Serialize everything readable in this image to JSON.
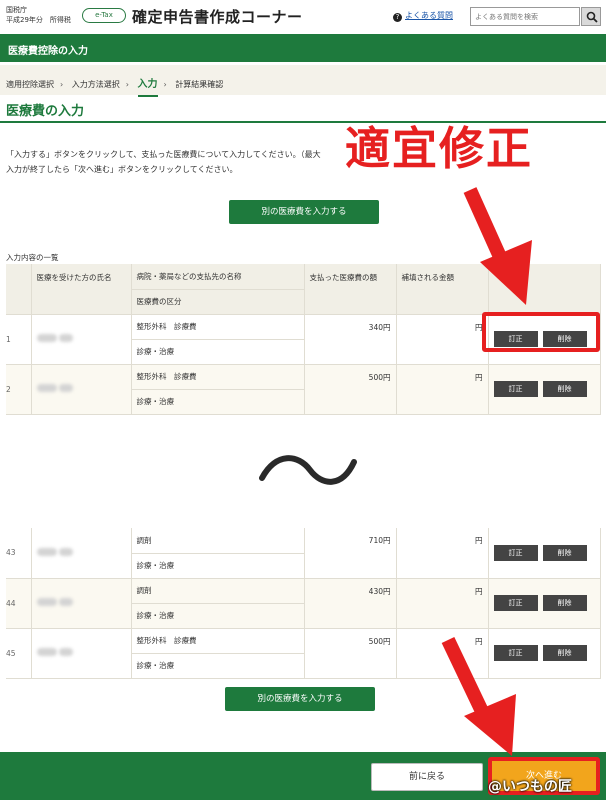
{
  "header": {
    "agency_line1": "国税庁",
    "agency_line2": "平成29年分　所得税",
    "etax_badge": "e-Tax",
    "app_title": "確定申告書作成コーナー",
    "faq_link": "よくある質問",
    "search_placeholder": "よくある質問を検索"
  },
  "section_bar": {
    "title": "医療費控除の入力"
  },
  "steps": [
    "適用控除選択",
    "入力方法選択",
    "入力",
    "計算結果確認"
  ],
  "page_title": "医療費の入力",
  "instructions": {
    "line1": "「入力する」ボタンをクリックして、支払った医療費について入力してください。（最大",
    "line2": "入力が終了したら「次へ進む」ボタンをクリックしてください。"
  },
  "annotation": {
    "overlay_text": "適宜修正"
  },
  "add_button_label": "別の医療費を入力する",
  "list_label": "入力内容の一覧",
  "table": {
    "headers": {
      "patient": "医療を受けた方の氏名",
      "provider": "病院・薬局などの支払先の名称",
      "category": "医療費の区分",
      "paid": "支払った医療費の額",
      "reimbursed": "補填される金額"
    },
    "edit_label": "訂正",
    "delete_label": "削除",
    "rows_top": [
      {
        "index": "1",
        "provider": "整形外科　診療費",
        "category": "診療・治療",
        "paid": "340円",
        "reimbursed": "円"
      },
      {
        "index": "2",
        "provider": "整形外科　診療費",
        "category": "診療・治療",
        "paid": "500円",
        "reimbursed": "円"
      }
    ],
    "rows_bottom": [
      {
        "index": "43",
        "provider": "調剤",
        "category": "診療・治療",
        "paid": "710円",
        "reimbursed": "円"
      },
      {
        "index": "44",
        "provider": "調剤",
        "category": "診療・治療",
        "paid": "430円",
        "reimbursed": "円"
      },
      {
        "index": "45",
        "provider": "整形外科　診療費",
        "category": "診療・治療",
        "paid": "500円",
        "reimbursed": "円"
      }
    ]
  },
  "footer": {
    "back_label": "前に戻る",
    "next_label": "次へ進む",
    "watermark": "@いつもの匠"
  },
  "colors": {
    "brand_green": "#1e7a3d",
    "annotation_red": "#e62020",
    "next_button": "#f2a51c"
  }
}
